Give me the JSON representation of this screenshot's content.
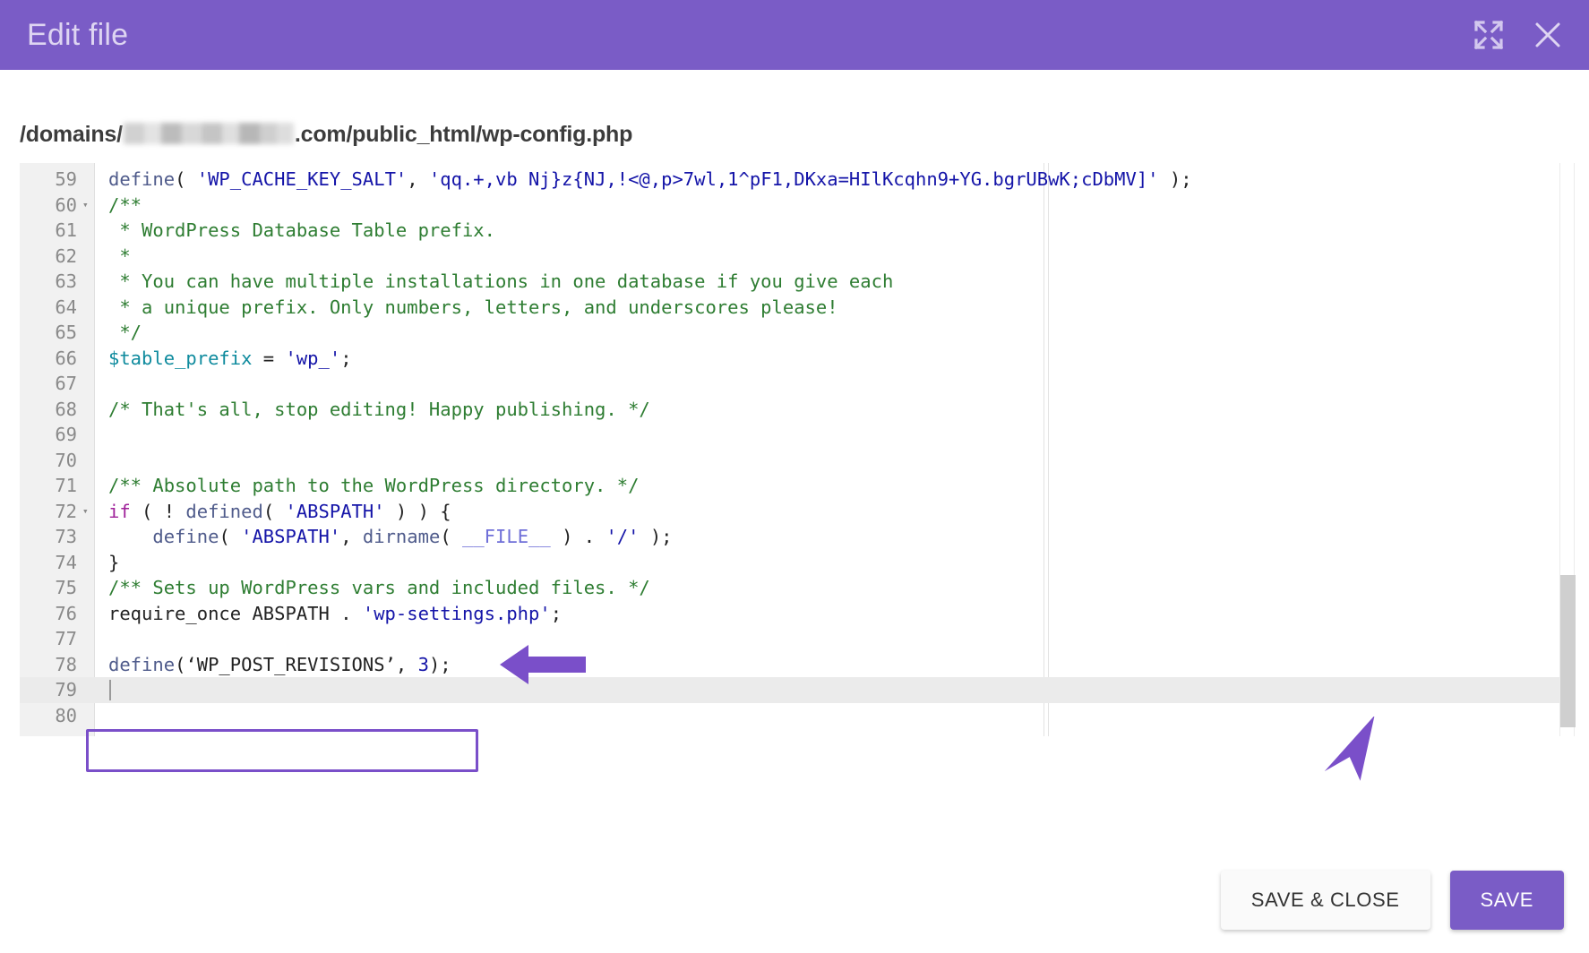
{
  "window": {
    "title": "Edit file",
    "expand_icon": "expand-icon",
    "close_icon": "close-icon"
  },
  "filepath": {
    "prefix": "/domains/",
    "redacted_label": "",
    "suffix": ".com/public_html/wp-config.php"
  },
  "editor": {
    "active_line": 79,
    "highlighted_line": 78,
    "lines": [
      {
        "n": "59",
        "fold": "",
        "tokens": [
          {
            "t": "define",
            "c": "c-def"
          },
          {
            "t": "( ",
            "c": "c-plain"
          },
          {
            "t": "'WP_CACHE_KEY_SALT'",
            "c": "c-str"
          },
          {
            "t": ", ",
            "c": "c-plain"
          },
          {
            "t": "'qq.+,vb Nj}z{NJ,!<@,p>7wl,1^pF1,DKxa=HIlKcqhn9+YG.bgrUBwK;cDbMV]'",
            "c": "c-str"
          },
          {
            "t": " );",
            "c": "c-plain"
          }
        ]
      },
      {
        "n": "60",
        "fold": "▾",
        "tokens": [
          {
            "t": "/**",
            "c": "c-com"
          }
        ]
      },
      {
        "n": "61",
        "fold": "",
        "tokens": [
          {
            "t": " * WordPress Database Table prefix.",
            "c": "c-com"
          }
        ]
      },
      {
        "n": "62",
        "fold": "",
        "tokens": [
          {
            "t": " *",
            "c": "c-com"
          }
        ]
      },
      {
        "n": "63",
        "fold": "",
        "tokens": [
          {
            "t": " * You can have multiple installations in one database if you give each",
            "c": "c-com"
          }
        ]
      },
      {
        "n": "64",
        "fold": "",
        "tokens": [
          {
            "t": " * a unique prefix. Only numbers, letters, and underscores please!",
            "c": "c-com"
          }
        ]
      },
      {
        "n": "65",
        "fold": "",
        "tokens": [
          {
            "t": " */",
            "c": "c-com"
          }
        ]
      },
      {
        "n": "66",
        "fold": "",
        "tokens": [
          {
            "t": "$table_prefix",
            "c": "c-var"
          },
          {
            "t": " = ",
            "c": "c-plain"
          },
          {
            "t": "'wp_'",
            "c": "c-str"
          },
          {
            "t": ";",
            "c": "c-plain"
          }
        ]
      },
      {
        "n": "67",
        "fold": "",
        "tokens": []
      },
      {
        "n": "68",
        "fold": "",
        "tokens": [
          {
            "t": "/* That's all, stop editing! Happy publishing. */",
            "c": "c-com"
          }
        ]
      },
      {
        "n": "69",
        "fold": "",
        "tokens": []
      },
      {
        "n": "70",
        "fold": "",
        "tokens": []
      },
      {
        "n": "71",
        "fold": "",
        "tokens": [
          {
            "t": "/** Absolute path to the WordPress directory. */",
            "c": "c-com"
          }
        ]
      },
      {
        "n": "72",
        "fold": "▾",
        "tokens": [
          {
            "t": "if",
            "c": "c-kw"
          },
          {
            "t": " ( ! ",
            "c": "c-plain"
          },
          {
            "t": "defined",
            "c": "c-def"
          },
          {
            "t": "( ",
            "c": "c-plain"
          },
          {
            "t": "'ABSPATH'",
            "c": "c-str"
          },
          {
            "t": " ) ) {",
            "c": "c-plain"
          }
        ]
      },
      {
        "n": "73",
        "fold": "",
        "tokens": [
          {
            "t": "    ",
            "c": "c-plain"
          },
          {
            "t": "define",
            "c": "c-def"
          },
          {
            "t": "( ",
            "c": "c-plain"
          },
          {
            "t": "'ABSPATH'",
            "c": "c-str"
          },
          {
            "t": ", ",
            "c": "c-plain"
          },
          {
            "t": "dirname",
            "c": "c-def"
          },
          {
            "t": "( ",
            "c": "c-plain"
          },
          {
            "t": "__FILE__",
            "c": "c-con"
          },
          {
            "t": " ) . ",
            "c": "c-plain"
          },
          {
            "t": "'/'",
            "c": "c-str"
          },
          {
            "t": " );",
            "c": "c-plain"
          }
        ]
      },
      {
        "n": "74",
        "fold": "",
        "tokens": [
          {
            "t": "}",
            "c": "c-plain"
          }
        ]
      },
      {
        "n": "75",
        "fold": "",
        "tokens": [
          {
            "t": "/** Sets up WordPress vars and included files. */",
            "c": "c-com"
          }
        ]
      },
      {
        "n": "76",
        "fold": "",
        "tokens": [
          {
            "t": "require_once",
            "c": "c-plain"
          },
          {
            "t": " ABSPATH . ",
            "c": "c-plain"
          },
          {
            "t": "'wp-settings.php'",
            "c": "c-str"
          },
          {
            "t": ";",
            "c": "c-plain"
          }
        ]
      },
      {
        "n": "77",
        "fold": "",
        "tokens": []
      },
      {
        "n": "78",
        "fold": "",
        "tokens": [
          {
            "t": "define",
            "c": "c-def"
          },
          {
            "t": "(‘WP_POST_REVISIONS’, ",
            "c": "c-plain"
          },
          {
            "t": "3",
            "c": "c-num"
          },
          {
            "t": ");",
            "c": "c-plain"
          }
        ]
      },
      {
        "n": "79",
        "fold": "",
        "tokens": []
      },
      {
        "n": "80",
        "fold": "",
        "tokens": []
      }
    ]
  },
  "footer": {
    "save_and_close_label": "SAVE & CLOSE",
    "save_label": "SAVE"
  },
  "colors": {
    "accent": "#7a5cc6",
    "annotation": "#7a4fc9",
    "header_text": "#ded5f2",
    "gutter": "#f1f1f1",
    "active_line": "#ebebeb"
  }
}
